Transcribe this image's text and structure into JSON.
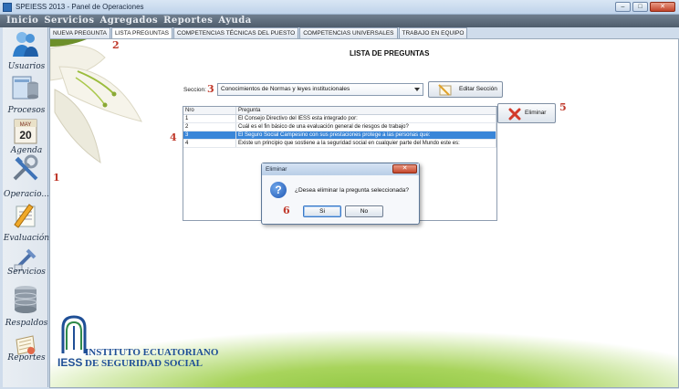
{
  "window": {
    "title": "SPEIESS 2013 - Panel de Operaciones"
  },
  "menu": [
    "Inicio",
    "Servicios",
    "Agregados",
    "Reportes",
    "Ayuda"
  ],
  "sidebar": {
    "items": [
      {
        "label": "Usuarios",
        "icon": "users-icon"
      },
      {
        "label": "Procesos",
        "icon": "database-icon"
      },
      {
        "label": "Agenda",
        "icon": "calendar-icon"
      },
      {
        "label": "Operacio...",
        "icon": "tools-icon"
      },
      {
        "label": "Evaluación",
        "icon": "pencil-icon"
      },
      {
        "label": "Servicios",
        "icon": "services-icon"
      },
      {
        "label": "Respaldos",
        "icon": "database-icon"
      },
      {
        "label": "Reportes",
        "icon": "report-icon"
      }
    ],
    "calendar": {
      "month": "MAY",
      "day": "20"
    }
  },
  "tabs": [
    {
      "label": "NUEVA PREGUNTA",
      "active": false
    },
    {
      "label": "LISTA PREGUNTAS",
      "active": true
    },
    {
      "label": "COMPETENCIAS TÉCNICAS DEL PUESTO",
      "active": false
    },
    {
      "label": "COMPETENCIAS UNIVERSALES",
      "active": false
    },
    {
      "label": "TRABAJO EN EQUIPO",
      "active": false
    }
  ],
  "panel": {
    "title": "LISTA DE PREGUNTAS",
    "seccion_label": "Seccion:",
    "seccion_value": "Conocimientos de Normas y leyes institucionales",
    "editar_label": "Editar Sección",
    "eliminar_label": "Eliminar"
  },
  "table": {
    "headers": [
      "Nro",
      "Pregunta"
    ],
    "rows": [
      {
        "nro": "1",
        "pregunta": "El Consejo Directivo del IESS esta integrado por:"
      },
      {
        "nro": "2",
        "pregunta": "Cuál es el fin básico de una evaluación general de riesgos de trabajo?"
      },
      {
        "nro": "3",
        "pregunta": "El Seguro Social Campesino con sus prestaciones protege a las personas que:"
      },
      {
        "nro": "4",
        "pregunta": "Existe un principio que sostiene a la seguridad social en cualquier parte del Mundo este es:"
      }
    ],
    "selected_row": 3
  },
  "dialog": {
    "title": "Eliminar",
    "message": "¿Desea eliminar la pregunta seleccionada?",
    "yes_label": "Si",
    "no_label": "No"
  },
  "logo": {
    "line1": "INSTITUTO ECUATORIANO",
    "line2": "DE SEGURIDAD SOCIAL",
    "mark": "IESS"
  },
  "annotations": [
    "1",
    "2",
    "3",
    "4",
    "5",
    "6"
  ],
  "colors": {
    "accent": "#3a86d8",
    "menubar": "#5f6d7c",
    "marker": "#c0392b"
  }
}
